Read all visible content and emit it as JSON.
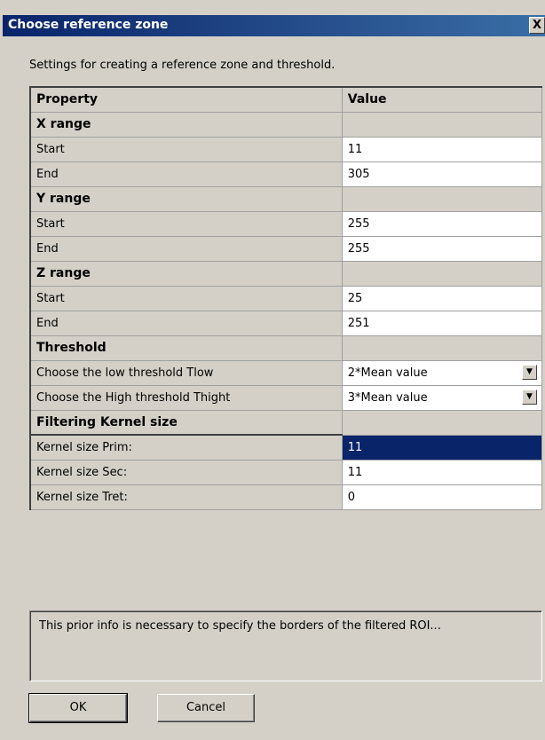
{
  "dialog": {
    "title": "Choose reference zone",
    "close_label": "X",
    "description": "Settings for creating a reference zone and threshold."
  },
  "grid": {
    "header": {
      "property": "Property",
      "value": "Value"
    },
    "rows": [
      {
        "type": "category",
        "name": "X range"
      },
      {
        "type": "prop",
        "name": "Start",
        "value": "11"
      },
      {
        "type": "prop",
        "name": "End",
        "value": "305"
      },
      {
        "type": "category",
        "name": "Y range"
      },
      {
        "type": "prop",
        "name": "Start",
        "value": "255"
      },
      {
        "type": "prop",
        "name": "End",
        "value": "255"
      },
      {
        "type": "category",
        "name": "Z range"
      },
      {
        "type": "prop",
        "name": "Start",
        "value": "25"
      },
      {
        "type": "prop",
        "name": "End",
        "value": "251"
      },
      {
        "type": "category",
        "name": "Threshold"
      },
      {
        "type": "dropdown",
        "name": "Choose the low threshold Tlow",
        "value": "2*Mean value"
      },
      {
        "type": "dropdown",
        "name": "Choose the High threshold Thight",
        "value": "3*Mean value"
      },
      {
        "type": "category",
        "name": "Filtering Kernel size"
      },
      {
        "type": "prop",
        "name": "Kernel size Prim:",
        "value": "11",
        "selected": true
      },
      {
        "type": "prop",
        "name": "Kernel size Sec:",
        "value": "11"
      },
      {
        "type": "prop",
        "name": "Kernel size Tret:",
        "value": "0"
      }
    ]
  },
  "info_text": "This prior info is necessary to specify the borders of the filtered ROI...",
  "buttons": {
    "ok": "OK",
    "cancel": "Cancel"
  }
}
